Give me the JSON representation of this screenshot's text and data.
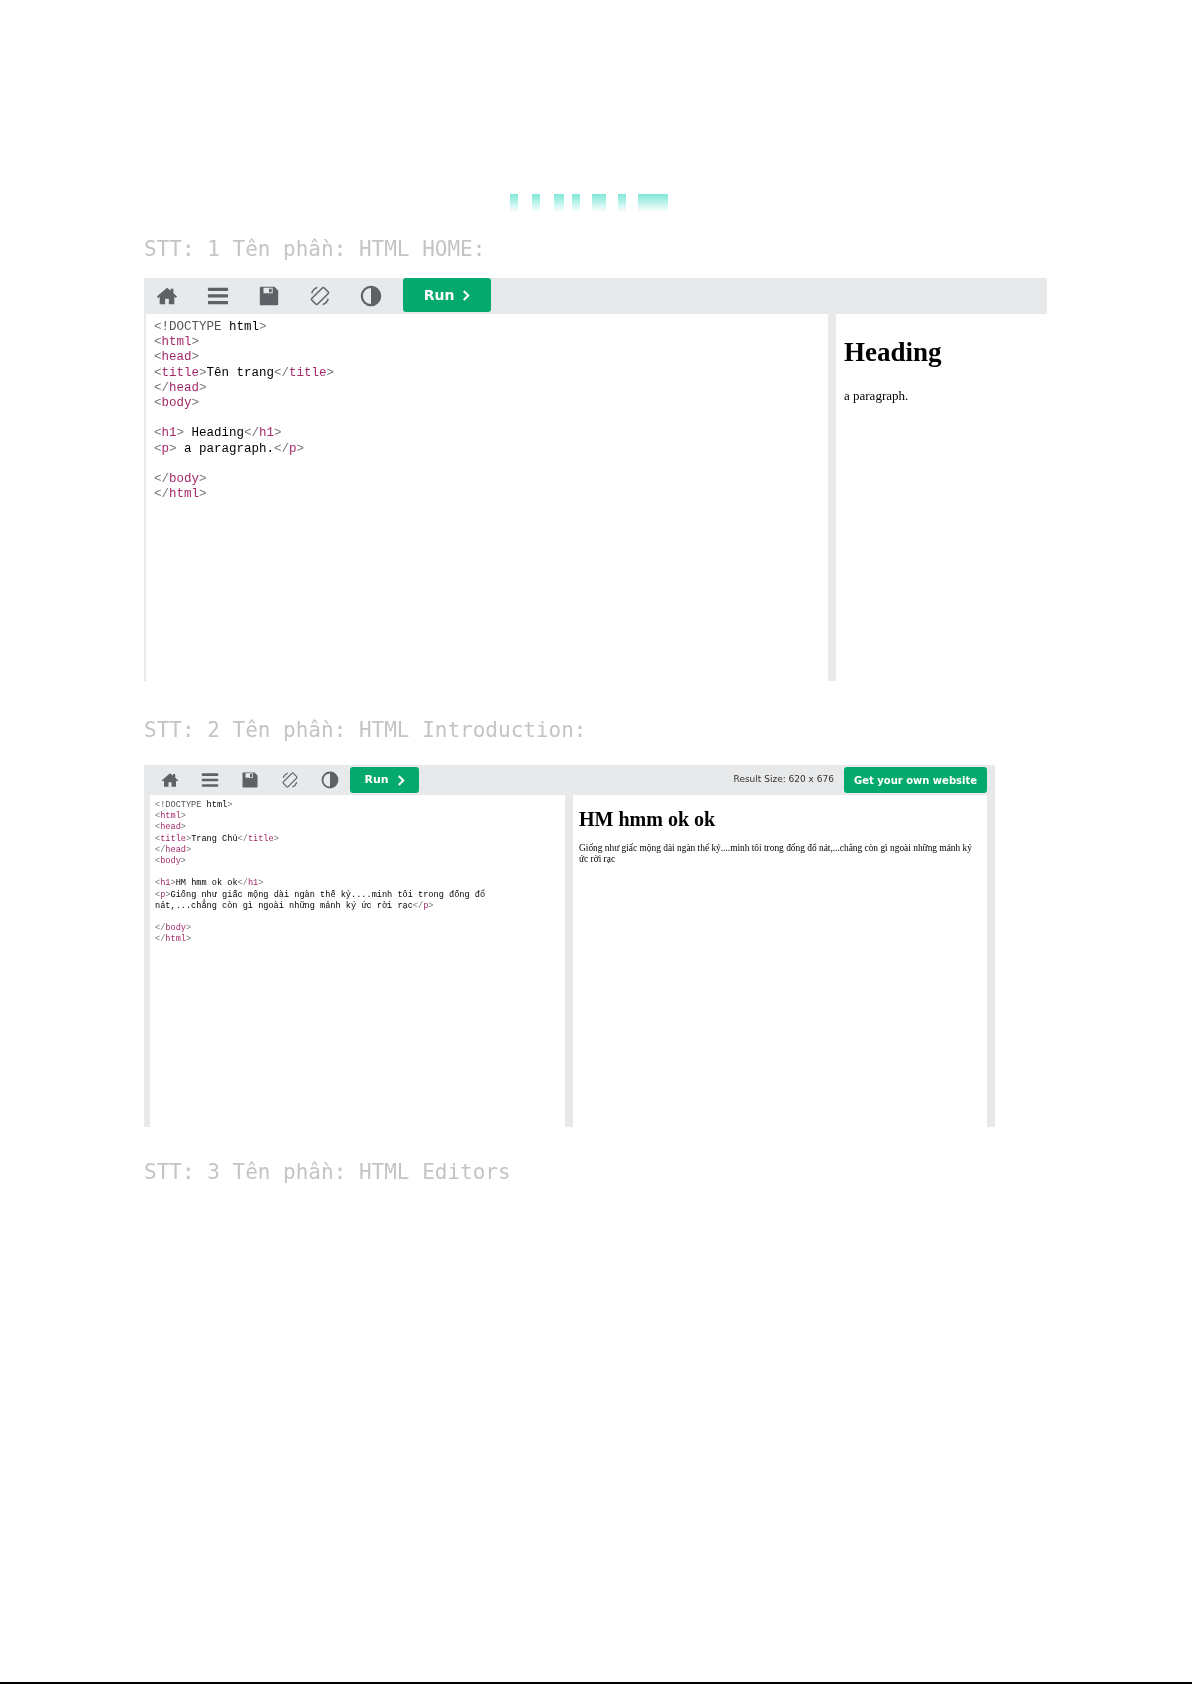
{
  "sections": [
    {
      "heading": "STT: 1 Tên phần: HTML HOME:",
      "editor": {
        "kind": "wide",
        "run_label": "Run",
        "code_blocks": [
          [
            "<!DOCTYPE html>",
            "<html>",
            "<head>",
            "<title>Tên trang</title>",
            "</head>",
            "<body>"
          ],
          [
            "<h1> Heading</h1>",
            "<p> a paragraph.</p>"
          ],
          [
            "</body>",
            "</html>"
          ]
        ],
        "preview": {
          "heading": "Heading",
          "paragraph": "a paragraph."
        }
      }
    },
    {
      "heading": "STT: 2 Tên phần: HTML Introduction:",
      "editor": {
        "kind": "compact",
        "run_label": "Run",
        "result_size": "Result Size: 620 x 676",
        "cta": "Get your own website",
        "code_blocks": [
          [
            "<!DOCTYPE html>",
            "<html>",
            "<head>",
            "<title>Trang Chủ</title>",
            "</head>",
            "<body>"
          ],
          [
            "<h1>HM hmm ok ok</h1>",
            "<p>Giống như giấc mộng dài ngàn thế kỷ....minh tôi trong đống đổ",
            "nát,...chẳng còn gì ngoài những mảnh ký ức rời rạc</p>"
          ],
          [
            "</body>",
            "</html>"
          ]
        ],
        "preview": {
          "heading": "HM hmm ok ok",
          "paragraph": "Giống như giấc mộng dài ngàn thế kỷ....minh tôi trong đống đổ nát,...chẳng còn gì ngoài những mảnh ký ức rời rạc"
        }
      }
    },
    {
      "heading": "STT: 3 Tên phần: HTML Editors"
    }
  ]
}
